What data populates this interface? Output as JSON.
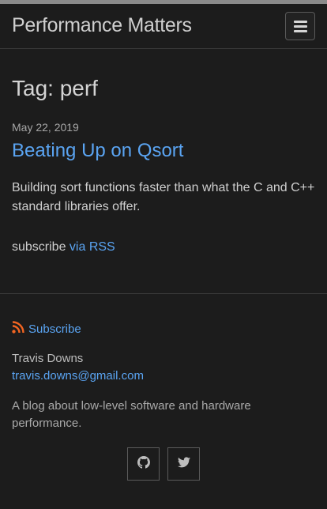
{
  "header": {
    "site_title": "Performance Matters"
  },
  "main": {
    "heading": "Tag: perf",
    "posts": [
      {
        "date": "May 22, 2019",
        "title": "Beating Up on Qsort",
        "excerpt": "Building sort functions faster than what the C and C++ standard libraries offer."
      }
    ],
    "subscribe": {
      "prefix": "subscribe ",
      "link": "via RSS"
    }
  },
  "footer": {
    "subscribe_label": "Subscribe",
    "author": "Travis Downs",
    "email": "travis.downs@gmail.com",
    "description": "A blog about low-level software and hardware performance."
  },
  "colors": {
    "link": "#5aa4f2",
    "rss": "#f26522",
    "background": "#1c1c1c"
  },
  "icons": [
    "menu-icon",
    "rss-icon",
    "github-icon",
    "twitter-icon"
  ]
}
